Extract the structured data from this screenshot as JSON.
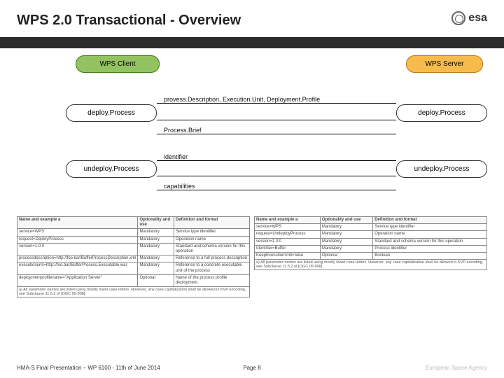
{
  "header": {
    "title": "WPS 2.0 Transactional - Overview",
    "logo_text": "esa"
  },
  "diagram": {
    "client": "WPS Client",
    "server": "WPS Server",
    "deploy_left": "deploy.Process",
    "deploy_right": "deploy.Process",
    "undeploy_left": "undeploy.Process",
    "undeploy_right": "undeploy.Process",
    "label_top": "provess.Description, Execution.Unit, Deployment.Profile",
    "label_processbrief": "Process.Brief",
    "label_identifier": "identifier",
    "label_capabilities": "capabilities"
  },
  "table_left": {
    "headers": [
      "Name and example a",
      "Optionality and use",
      "Definition and format"
    ],
    "rows": [
      [
        "service=WPS",
        "Mandatory",
        "Service type identifier"
      ],
      [
        "request=DeployProcess",
        "Mandatory",
        "Operation name"
      ],
      [
        "version=1.0.0",
        "Mandatory",
        "Standard and schema version for this operation"
      ],
      [
        "processdescription=http://foo.bar/BufferProcessDescription.xml",
        "Mandatory",
        "Reference to a full process description"
      ],
      [
        "executionunit=http://foo.bar/BufferProcess.Executable.war",
        "Mandatory",
        "Reference to a concrete executable unit of the process"
      ],
      [
        "deploymentprofilename=\"Application Server\"",
        "Optional",
        "Name of the process profile deployment."
      ]
    ],
    "note": "a) All parameter names are listed using mostly lower case letters. However, any case capitalization shall be allowed in KVP encoding, see Subclause 11.5.2 of [OGC 05-008]."
  },
  "table_right": {
    "headers": [
      "Name and example a",
      "Optionality and use",
      "Definition and format"
    ],
    "rows": [
      [
        "service=WPS",
        "Mandatory",
        "Service type identifier"
      ],
      [
        "request=UndeployProcess",
        "Mandatory",
        "Operation name"
      ],
      [
        "version=1.0.0",
        "Mandatory",
        "Standard and schema version for this operation"
      ],
      [
        "Identifier=Buffer",
        "Mandatory",
        "Process identifier"
      ],
      [
        "KeepExecutionUnit=false",
        "Optional",
        "Boolean"
      ]
    ],
    "note": "a) All parameter names are listed using mostly lower case letters. However, any case capitalization shall be allowed in KVP encoding, see Subclause 11.5.2 of [OGC 05-008]."
  },
  "footer": {
    "left": "HMA-S Final Presentation – WP 6100 - 11th of June 2014",
    "page": "Page 8",
    "right": "European Space Agency"
  }
}
